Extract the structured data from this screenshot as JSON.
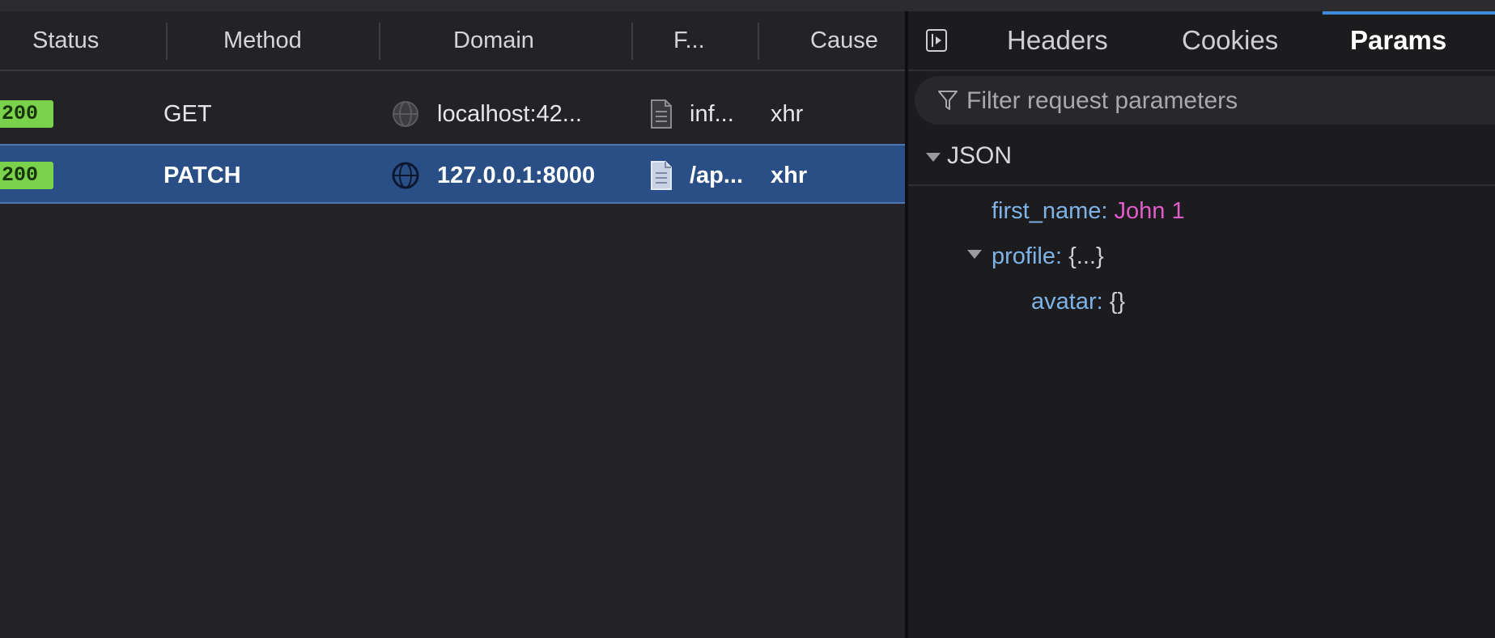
{
  "request_list": {
    "columns": [
      "Status",
      "Method",
      "Domain",
      "F...",
      "Cause"
    ],
    "rows": [
      {
        "status": "200",
        "method": "GET",
        "domain": "localhost:42...",
        "file": "inf...",
        "cause": "xhr",
        "selected": false
      },
      {
        "status": "200",
        "method": "PATCH",
        "domain": "127.0.0.1:8000",
        "file": "/ap...",
        "cause": "xhr",
        "selected": true
      }
    ]
  },
  "details": {
    "tabs": [
      "Headers",
      "Cookies",
      "Params"
    ],
    "active_tab": "Params",
    "filter_placeholder": "Filter request parameters",
    "section_label": "JSON",
    "tree": {
      "first_name_key": "first_name:",
      "first_name_value": "John 1",
      "profile_key": "profile:",
      "profile_value": "{...}",
      "avatar_key": "avatar:",
      "avatar_value": "{}"
    }
  },
  "colors": {
    "status_ok": "#7ad14c",
    "selected_row": "#2a4f86",
    "string_value": "#e05cc8",
    "key": "#7fb3e6",
    "tab_underline": "#3f8bdb"
  },
  "icons": [
    "globe-icon",
    "file-icon",
    "sidebar-toggle-icon",
    "filter-icon",
    "expand-triangle-icon"
  ]
}
